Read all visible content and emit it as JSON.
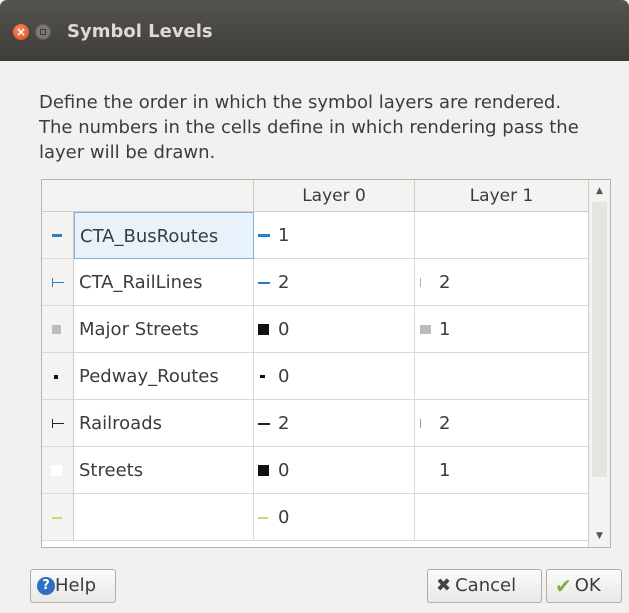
{
  "window": {
    "title": "Symbol Levels"
  },
  "description": "Define the order in which the symbol layers are rendered. The numbers in the cells define in which rendering pass the layer will be drawn.",
  "table": {
    "headers": [
      "",
      "Layer 0",
      "Layer 1"
    ],
    "rows": [
      {
        "name": "CTA_BusRoutes",
        "layer0": "1",
        "layer1": "",
        "selected": true,
        "icon": "blue-line-icon"
      },
      {
        "name": "CTA_RailLines",
        "layer0": "2",
        "layer1": "2",
        "selected": false,
        "icon": "blue-line-icon"
      },
      {
        "name": "Major Streets",
        "layer0": "0",
        "layer1": "1",
        "selected": false,
        "icon": "gray-square-icon"
      },
      {
        "name": "Pedway_Routes",
        "layer0": "0",
        "layer1": "",
        "selected": false,
        "icon": "black-dot-icon"
      },
      {
        "name": "Railroads",
        "layer0": "2",
        "layer1": "2",
        "selected": false,
        "icon": "black-line-icon"
      },
      {
        "name": "Streets",
        "layer0": "0",
        "layer1": "1",
        "selected": false,
        "icon": "white-square-icon"
      },
      {
        "name": "",
        "layer0": "0",
        "layer1": "",
        "selected": false,
        "icon": "green-line-icon"
      }
    ]
  },
  "buttons": {
    "help": "Help",
    "cancel": "Cancel",
    "ok": "OK"
  },
  "colors": {
    "titlebar": "#3f3d39",
    "close": "#df4a17",
    "blue": "#2a7fc9",
    "green": "#c6d87a",
    "selected": "#e9f2fb"
  }
}
